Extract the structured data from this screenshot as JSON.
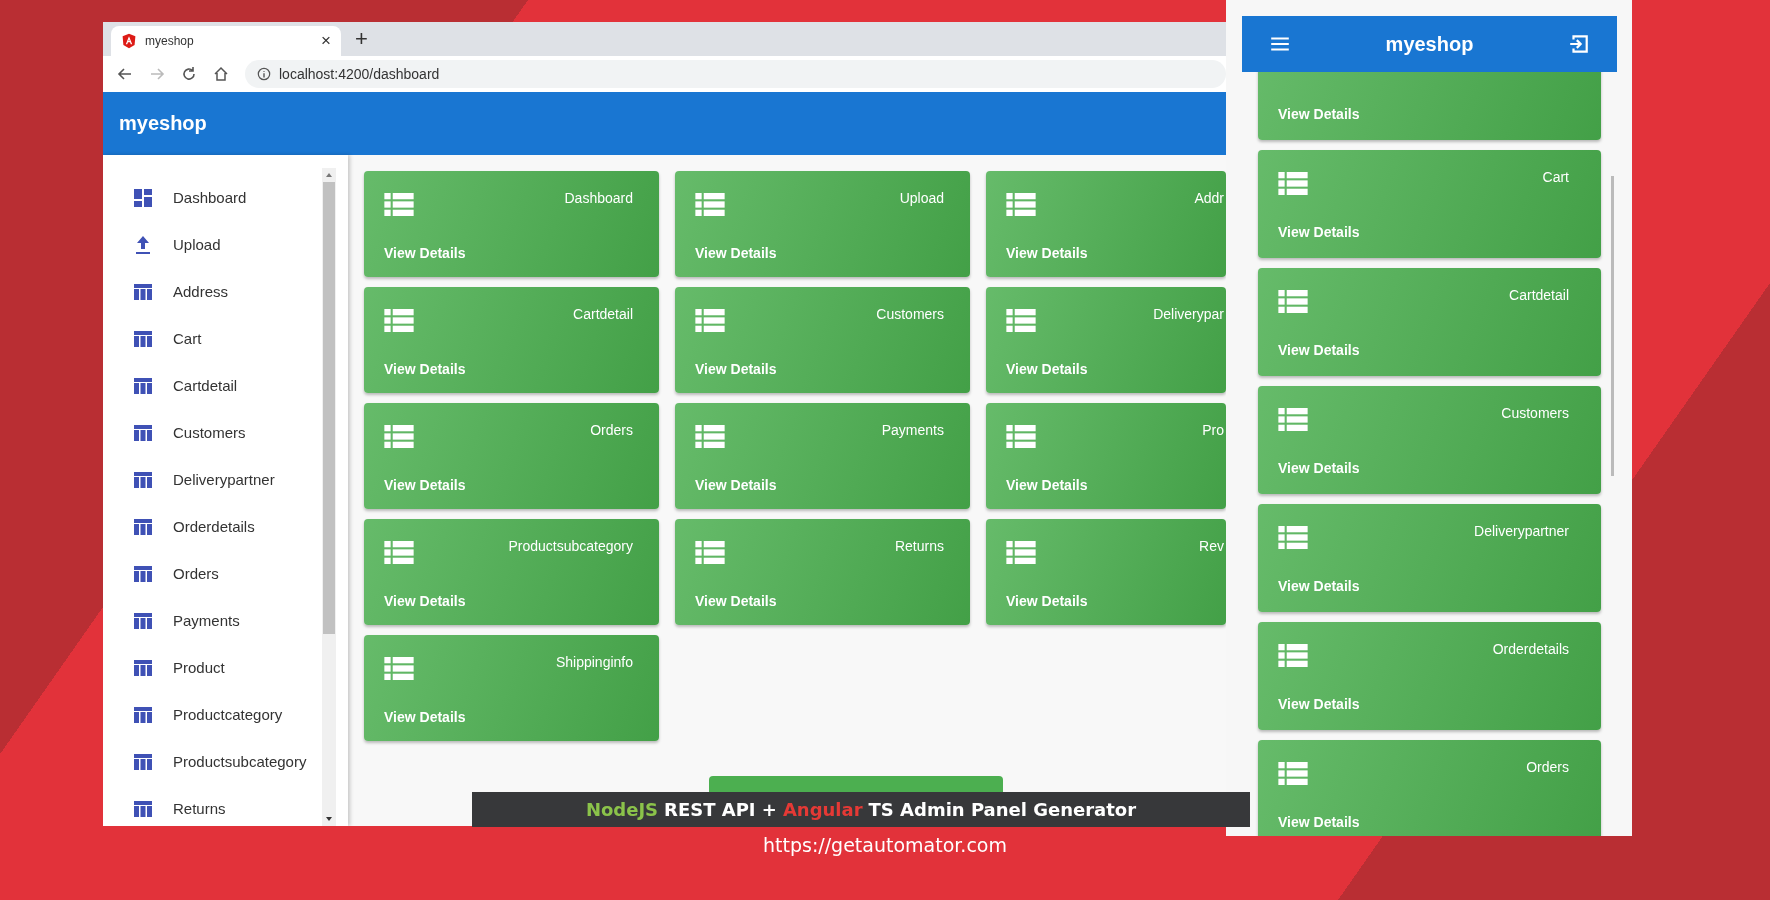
{
  "browser": {
    "tab_title": "myeshop",
    "new_tab": "+",
    "close_tab": "×",
    "address": "localhost:4200/dashboard"
  },
  "app": {
    "title": "myeshop"
  },
  "sidebar": {
    "items": [
      {
        "label": "Dashboard",
        "kind": "dashboard"
      },
      {
        "label": "Upload",
        "kind": "upload"
      },
      {
        "label": "Address",
        "kind": "table"
      },
      {
        "label": "Cart",
        "kind": "table"
      },
      {
        "label": "Cartdetail",
        "kind": "table"
      },
      {
        "label": "Customers",
        "kind": "table"
      },
      {
        "label": "Deliverypartner",
        "kind": "table"
      },
      {
        "label": "Orderdetails",
        "kind": "table"
      },
      {
        "label": "Orders",
        "kind": "table"
      },
      {
        "label": "Payments",
        "kind": "table"
      },
      {
        "label": "Product",
        "kind": "table"
      },
      {
        "label": "Productcategory",
        "kind": "table"
      },
      {
        "label": "Productsubcategory",
        "kind": "table"
      },
      {
        "label": "Returns",
        "kind": "table"
      }
    ]
  },
  "cards": [
    {
      "title": "Dashboard",
      "link": "View Details"
    },
    {
      "title": "Upload",
      "link": "View Details"
    },
    {
      "title": "Addr",
      "link": "View Details"
    },
    {
      "title": "Cartdetail",
      "link": "View Details"
    },
    {
      "title": "Customers",
      "link": "View Details"
    },
    {
      "title": "Deliverypar",
      "link": "View Details"
    },
    {
      "title": "Orders",
      "link": "View Details"
    },
    {
      "title": "Payments",
      "link": "View Details"
    },
    {
      "title": "Pro",
      "link": "View Details"
    },
    {
      "title": "Productsubcategory",
      "link": "View Details"
    },
    {
      "title": "Returns",
      "link": "View Details"
    },
    {
      "title": "Rev",
      "link": "View Details"
    },
    {
      "title": "Shippinginfo",
      "link": "View Details"
    }
  ],
  "mobile": {
    "title": "myeshop",
    "cards": [
      {
        "link": "View Details"
      },
      {
        "title": "Cart",
        "link": "View Details"
      },
      {
        "title": "Cartdetail",
        "link": "View Details"
      },
      {
        "title": "Customers",
        "link": "View Details"
      },
      {
        "title": "Deliverypartner",
        "link": "View Details"
      },
      {
        "title": "Orderdetails",
        "link": "View Details"
      },
      {
        "title": "Orders",
        "link": "View Details"
      }
    ]
  },
  "banner": {
    "segments": [
      {
        "text": "NodeJS",
        "color": "#8bc34a"
      },
      {
        "text": "REST API +",
        "color": "#ffffff"
      },
      {
        "text": "Angular",
        "color": "#e53935"
      },
      {
        "text": "TS Admin Panel Generator",
        "color": "#ffffff"
      }
    ],
    "url": "https://getautomator.com"
  }
}
